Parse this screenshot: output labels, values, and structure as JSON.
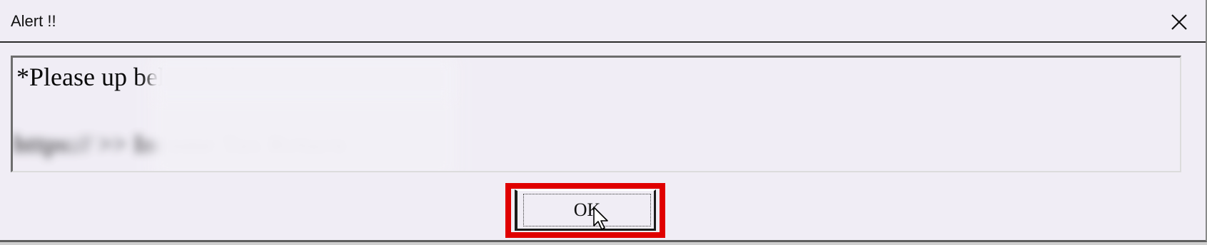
{
  "dialog": {
    "title": "Alert !!",
    "close_icon": "close-icon",
    "message": {
      "line1": "*Please up                                  below link",
      "line2": "https://                                  >> Income Tax Return"
    },
    "ok_label": "OK",
    "highlight_color": "#e00000"
  }
}
